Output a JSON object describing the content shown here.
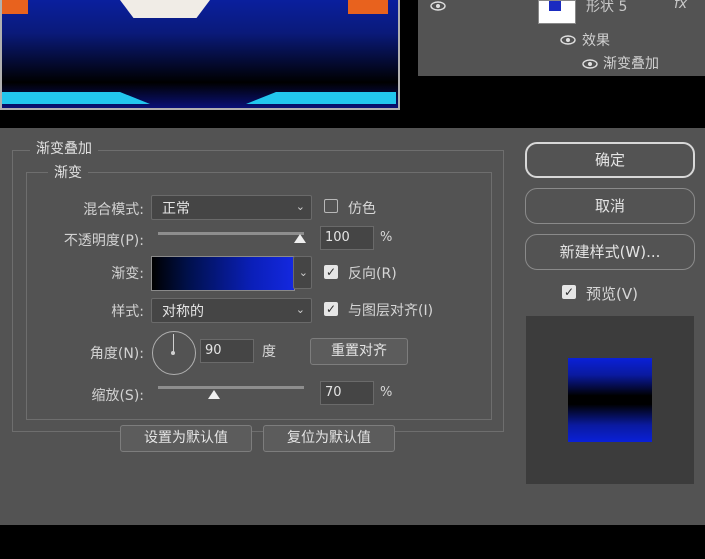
{
  "layers": {
    "layer_name": "形状 5",
    "fx": "fx",
    "effects_label": "效果",
    "effect_item": "渐变叠加"
  },
  "dialog": {
    "group_title": "渐变叠加",
    "subgroup_title": "渐变",
    "blend_mode": {
      "label": "混合模式:",
      "value": "正常"
    },
    "dither": {
      "label": "仿色",
      "checked": false
    },
    "opacity": {
      "label": "不透明度(P):",
      "value": "100",
      "unit": "%",
      "level": 100
    },
    "gradient": {
      "label": "渐变:",
      "colors": [
        "#000000",
        "#00104a",
        "#0a1fb8",
        "#1428e0"
      ]
    },
    "reverse": {
      "label": "反向(R)",
      "checked": true
    },
    "style": {
      "label": "样式:",
      "value": "对称的"
    },
    "align_with_layer": {
      "label": "与图层对齐(I)",
      "checked": true
    },
    "angle": {
      "label": "角度(N):",
      "value": "90",
      "unit": "度"
    },
    "reset_alignment_label": "重置对齐",
    "scale": {
      "label": "缩放(S):",
      "value": "70",
      "unit": "%",
      "level": 70
    },
    "make_default_label": "设置为默认值",
    "reset_default_label": "复位为默认值"
  },
  "buttons": {
    "ok_label": "确定",
    "cancel_label": "取消",
    "new_style_label": "新建样式(W)...",
    "preview": {
      "label": "预览(V)",
      "checked": true
    }
  },
  "colors": {
    "dialog_bg": "#535353",
    "gradient_blue": "#0a20d8",
    "canvas_orange": "#e8621e",
    "canvas_cyan": "#22c6ee"
  }
}
